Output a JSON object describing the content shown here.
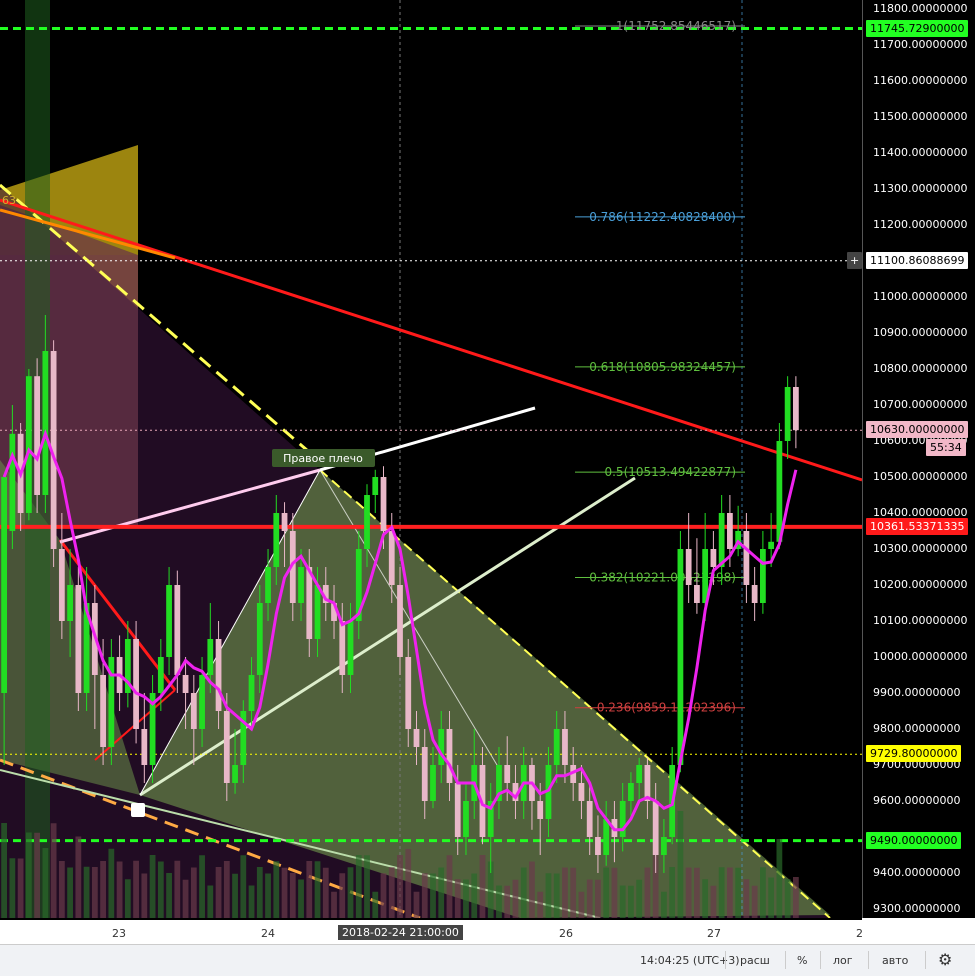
{
  "chart_data": {
    "type": "candlestick",
    "symbol_timeframe": "",
    "y_range": [
      9275,
      11825
    ],
    "x_dates": [
      "23",
      "24",
      "26",
      "27",
      "2"
    ],
    "crosshair_time": "2018-02-24 21:00:00",
    "candles": [
      [
        9900,
        10500,
        10350,
        9700
      ],
      [
        10350,
        10620,
        10700,
        10300
      ],
      [
        10620,
        10400,
        10650,
        10350
      ],
      [
        10400,
        10780,
        10800,
        10380
      ],
      [
        10780,
        10450,
        10830,
        10400
      ],
      [
        10450,
        10850,
        10950,
        10400
      ],
      [
        10850,
        10300,
        10880,
        10250
      ],
      [
        10300,
        10100,
        10400,
        10050
      ],
      [
        10100,
        10200,
        10300,
        10000
      ],
      [
        10200,
        9900,
        10250,
        9850
      ],
      [
        9900,
        10150,
        10250,
        9850
      ],
      [
        10150,
        9950,
        10200,
        9800
      ],
      [
        9950,
        9750,
        10050,
        9700
      ],
      [
        9750,
        10000,
        10050,
        9700
      ],
      [
        10000,
        9900,
        10060,
        9850
      ],
      [
        9900,
        10050,
        10100,
        9860
      ],
      [
        10050,
        9800,
        10100,
        9760
      ],
      [
        9800,
        9700,
        9900,
        9650
      ],
      [
        9700,
        9900,
        9950,
        9650
      ],
      [
        9900,
        10000,
        10050,
        9850
      ],
      [
        10000,
        10200,
        10250,
        9950
      ],
      [
        10200,
        9950,
        10240,
        9900
      ],
      [
        9950,
        9900,
        10000,
        9800
      ],
      [
        9900,
        9800,
        9950,
        9700
      ],
      [
        9800,
        9950,
        10000,
        9750
      ],
      [
        9950,
        10050,
        10150,
        9900
      ],
      [
        10050,
        9850,
        10100,
        9800
      ],
      [
        9850,
        9650,
        9900,
        9600
      ],
      [
        9650,
        9700,
        9800,
        9620
      ],
      [
        9700,
        9850,
        9880,
        9650
      ],
      [
        9850,
        9950,
        10000,
        9800
      ],
      [
        9950,
        10150,
        10200,
        9900
      ],
      [
        10150,
        10250,
        10300,
        10100
      ],
      [
        10250,
        10400,
        10450,
        10200
      ],
      [
        10400,
        10350,
        10430,
        10250
      ],
      [
        10350,
        10150,
        10400,
        10100
      ],
      [
        10150,
        10250,
        10300,
        10100
      ],
      [
        10250,
        10050,
        10300,
        10000
      ],
      [
        10050,
        10200,
        10250,
        10000
      ],
      [
        10200,
        10150,
        10250,
        10100
      ],
      [
        10150,
        10100,
        10200,
        10050
      ],
      [
        10100,
        9950,
        10150,
        9900
      ],
      [
        9950,
        10100,
        10150,
        9900
      ],
      [
        10100,
        10300,
        10350,
        10050
      ],
      [
        10300,
        10450,
        10480,
        10250
      ],
      [
        10450,
        10500,
        10520,
        10400
      ],
      [
        10500,
        10350,
        10530,
        10300
      ],
      [
        10350,
        10200,
        10400,
        10150
      ],
      [
        10200,
        10000,
        10250,
        9950
      ],
      [
        10000,
        9800,
        10050,
        9750
      ],
      [
        9800,
        9750,
        9850,
        9700
      ],
      [
        9750,
        9600,
        9800,
        9550
      ],
      [
        9600,
        9700,
        9750,
        9580
      ],
      [
        9700,
        9800,
        9850,
        9650
      ],
      [
        9800,
        9650,
        9850,
        9600
      ],
      [
        9650,
        9500,
        9700,
        9450
      ],
      [
        9500,
        9600,
        9650,
        9450
      ],
      [
        9600,
        9700,
        9800,
        9550
      ],
      [
        9700,
        9500,
        9750,
        9480
      ],
      [
        9500,
        9600,
        9650,
        9400
      ],
      [
        9600,
        9700,
        9750,
        9550
      ],
      [
        9700,
        9650,
        9780,
        9600
      ],
      [
        9650,
        9600,
        9700,
        9550
      ],
      [
        9600,
        9700,
        9750,
        9550
      ],
      [
        9700,
        9600,
        9720,
        9520
      ],
      [
        9600,
        9550,
        9650,
        9450
      ],
      [
        9550,
        9700,
        9750,
        9500
      ],
      [
        9700,
        9800,
        9850,
        9650
      ],
      [
        9800,
        9700,
        9850,
        9650
      ],
      [
        9700,
        9650,
        9750,
        9600
      ],
      [
        9650,
        9600,
        9700,
        9550
      ],
      [
        9600,
        9500,
        9650,
        9450
      ],
      [
        9500,
        9450,
        9560,
        9400
      ],
      [
        9450,
        9550,
        9600,
        9420
      ],
      [
        9550,
        9500,
        9600,
        9430
      ],
      [
        9500,
        9600,
        9650,
        9460
      ],
      [
        9600,
        9650,
        9680,
        9550
      ],
      [
        9650,
        9700,
        9720,
        9600
      ],
      [
        9700,
        9600,
        9720,
        9550
      ],
      [
        9600,
        9450,
        9650,
        9400
      ],
      [
        9450,
        9500,
        9550,
        9400
      ],
      [
        9500,
        9700,
        9750,
        9480
      ],
      [
        9700,
        10300,
        10350,
        9680
      ],
      [
        10300,
        10200,
        10400,
        10150
      ],
      [
        10200,
        10150,
        10330,
        10120
      ],
      [
        10150,
        10300,
        10400,
        10100
      ],
      [
        10300,
        10250,
        10350,
        10200
      ],
      [
        10250,
        10400,
        10450,
        10200
      ],
      [
        10400,
        10300,
        10450,
        10250
      ],
      [
        10300,
        10350,
        10420,
        10280
      ],
      [
        10350,
        10200,
        10400,
        10150
      ],
      [
        10200,
        10150,
        10250,
        10100
      ],
      [
        10150,
        10300,
        10350,
        10120
      ],
      [
        10300,
        10320,
        10400,
        10250
      ],
      [
        10320,
        10600,
        10650,
        10300
      ],
      [
        10600,
        10750,
        10780,
        10550
      ],
      [
        10750,
        10630,
        10780,
        10580
      ]
    ],
    "fib_levels": [
      {
        "ratio": "1",
        "label": "1(11752.85446517)",
        "value": 11752.85446517
      },
      {
        "ratio": "0.786",
        "label": "0.786(11222.40828400)",
        "value": 11222.408284
      },
      {
        "ratio": "0.618",
        "label": "0.618(10805.98324457)",
        "value": 10805.98324457
      },
      {
        "ratio": "0.5",
        "label": "0.5(10513.49422877)",
        "value": 10513.49422877
      },
      {
        "ratio": "0.382",
        "label": "0.382(10221.00521298)",
        "value": 10221.00521298
      },
      {
        "ratio": "0.236",
        "label": "0.236(9859.11202396)",
        "value": 9859.11202396
      }
    ],
    "horizontal_lines": [
      {
        "value": 11745.729,
        "label": "11745.72900000",
        "color": "#22ff22",
        "style": "dashed"
      },
      {
        "value": 11100.86088699,
        "label": "11100.86088699",
        "color": "#ffffff",
        "style": "dotted"
      },
      {
        "value": 10630.0,
        "label": "10630.00000000",
        "color": "#e8a8b8",
        "style": "dotted"
      },
      {
        "value": 10361.53371335,
        "label": "10361.53371335",
        "color": "#ff2020",
        "style": "solid"
      },
      {
        "value": 9729.8,
        "label": "9729.80000000",
        "color": "#ffff00",
        "style": "dotted"
      },
      {
        "value": 9490.0,
        "label": "9490.00000000",
        "color": "#22ff22",
        "style": "dashed"
      }
    ],
    "price_ticks": [
      11800,
      11700,
      11600,
      11500,
      11400,
      11300,
      11200,
      11100,
      11000,
      10900,
      10800,
      10700,
      10600,
      10500,
      10400,
      10300,
      10200,
      10100,
      10000,
      9900,
      9800,
      9700,
      9600,
      9500,
      9400,
      9300
    ],
    "countdown": "55:34",
    "annotation": "Правое плечо",
    "partial_label": "63"
  },
  "status": {
    "time": "14:04:25 (UTC+3)",
    "extended": "расш",
    "percent": "%",
    "log": "лог",
    "auto": "авто",
    "settings_icon": "gear-icon"
  },
  "colors": {
    "up": "#22dd22",
    "down": "#e8b8c8",
    "ma": "#ee22ee",
    "trend_red": "#ff1a1a",
    "fib_green": "#5fbf3f",
    "fib_blue": "#4a9fd8",
    "fib_red": "#d04040"
  }
}
